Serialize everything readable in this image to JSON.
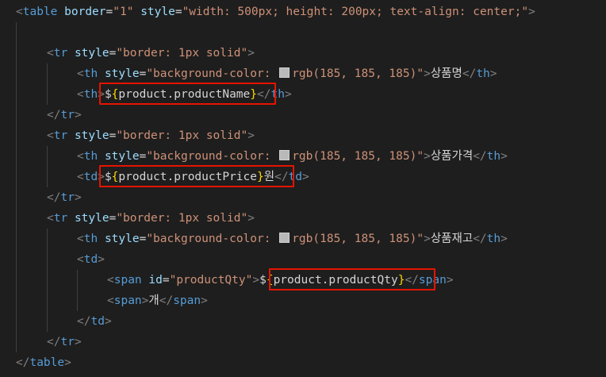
{
  "code": {
    "table_open": {
      "tag": "table",
      "attr1_name": "border",
      "attr1_value": "\"1\"",
      "attr2_name": "style",
      "attr2_value": "\"width: 500px; height: 200px; text-align: center;\""
    },
    "tr_tag": "tr",
    "tr_style_name": "style",
    "tr_style_value": "\"border: 1px solid\"",
    "th_tag": "th",
    "td_tag": "td",
    "span_tag": "span",
    "th_style_name": "style",
    "th_style_prefix": "\"background-color: ",
    "th_style_color": "rgb(185, 185, 185)",
    "th_style_suffix": "\"",
    "swatch_color": "#b9b9b9",
    "row1": {
      "header_label": "상품명",
      "value_expr": "product.productName",
      "value_suffix": ""
    },
    "row2": {
      "header_label": "상품가격",
      "value_expr": "product.productPrice",
      "value_suffix": "원"
    },
    "row3": {
      "header_label": "상품재고",
      "span_id_name": "id",
      "span_id_value": "\"productQty\"",
      "value_expr": "product.productQty",
      "unit_label": "개"
    },
    "dollar": "$",
    "brace_open": "{",
    "brace_close": "}"
  },
  "colors": {
    "background": "#1e1e1e",
    "tag": "#569cd6",
    "attribute": "#9cdcfe",
    "string": "#ce9178",
    "brace": "#ffd700",
    "highlight_box": "#e51400"
  }
}
